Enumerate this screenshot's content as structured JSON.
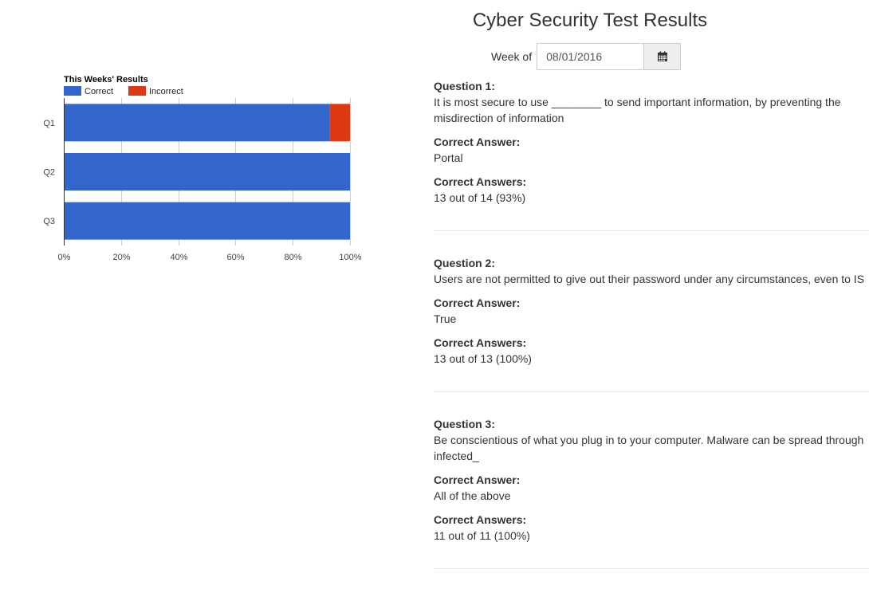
{
  "page": {
    "title": "Cyber Security Test Results"
  },
  "week": {
    "label": "Week of",
    "value": "08/01/2016"
  },
  "chart_data": {
    "type": "bar",
    "orientation": "horizontal",
    "stacked": "percent",
    "title": "This Weeks' Results",
    "categories": [
      "Q1",
      "Q2",
      "Q3"
    ],
    "series": [
      {
        "name": "Correct",
        "values": [
          13,
          13,
          11
        ],
        "color": "#3366cc"
      },
      {
        "name": "Incorrect",
        "values": [
          1,
          0,
          0
        ],
        "color": "#dc3912"
      }
    ],
    "xlim": [
      0,
      100
    ],
    "xticks": [
      "0%",
      "20%",
      "40%",
      "60%",
      "80%",
      "100%"
    ],
    "legend": "top",
    "grid": true
  },
  "questions": [
    {
      "label": "Question 1:",
      "text": "It is most secure to use ________ to send important information, by preventing the misdirection of information",
      "answer_label": "Correct Answer:",
      "answer": "Portal",
      "count_label": "Correct Answers:",
      "count": "13 out of 14 (93%)"
    },
    {
      "label": "Question 2:",
      "text": "Users are not permitted to give out their password under any circumstances, even to IS",
      "answer_label": "Correct Answer:",
      "answer": "True",
      "count_label": "Correct Answers:",
      "count": "13 out of 13 (100%)"
    },
    {
      "label": "Question 3:",
      "text": "Be conscientious of what you plug in to your computer. Malware can be spread through infected_",
      "answer_label": "Correct Answer:",
      "answer": "All of the above",
      "count_label": "Correct Answers:",
      "count": "11 out of 11 (100%)"
    }
  ]
}
